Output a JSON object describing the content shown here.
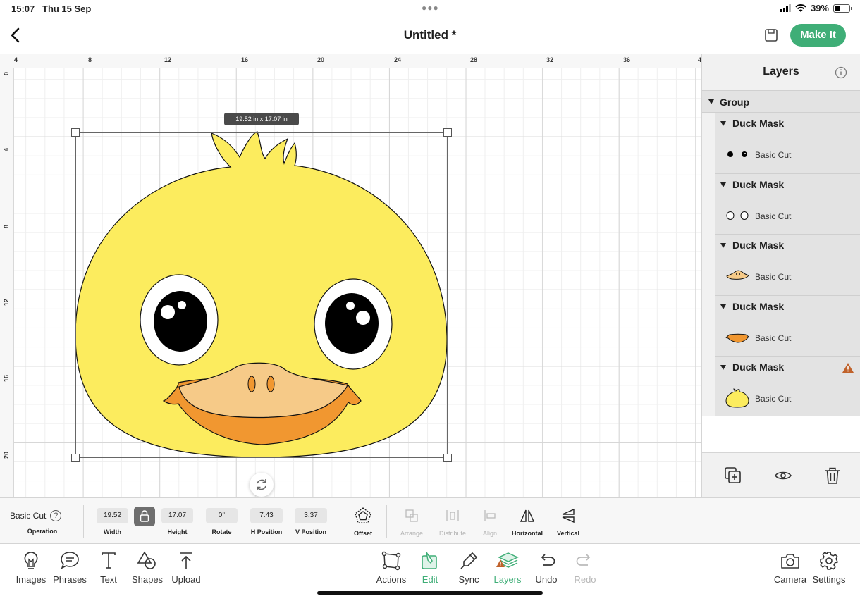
{
  "status_bar": {
    "time": "15:07",
    "date": "Thu 15 Sep",
    "battery": "39%",
    "battery_level": 0.39
  },
  "header": {
    "title": "Untitled *",
    "make_it_label": "Make It",
    "accent_color": "#3fae77"
  },
  "canvas": {
    "ruler_top": [
      "4",
      "8",
      "12",
      "16",
      "20",
      "24",
      "28",
      "32",
      "36",
      "4"
    ],
    "ruler_left": [
      "0",
      "4",
      "8",
      "12",
      "16",
      "20"
    ],
    "size_tooltip": "19.52 in x 17.07 in"
  },
  "layers_panel": {
    "title": "Layers",
    "group_label": "Group",
    "items": [
      {
        "name": "Duck Mask",
        "layer": "Basic Cut",
        "thumb": "pupils",
        "warning": false
      },
      {
        "name": "Duck Mask",
        "layer": "Basic Cut",
        "thumb": "eye-whites",
        "warning": false
      },
      {
        "name": "Duck Mask",
        "layer": "Basic Cut",
        "thumb": "beak-top",
        "warning": false
      },
      {
        "name": "Duck Mask",
        "layer": "Basic Cut",
        "thumb": "beak-bottom",
        "warning": true
      },
      {
        "name": "Duck Mask",
        "layer": "Basic Cut",
        "thumb": "duck-head",
        "warning": true
      }
    ]
  },
  "edit_toolbar": {
    "operation_value": "Basic Cut",
    "operation_label": "Operation",
    "width_value": "19.52",
    "width_label": "Width",
    "height_value": "17.07",
    "height_label": "Height",
    "rotate_value": "0°",
    "rotate_label": "Rotate",
    "hpos_value": "7.43",
    "hpos_label": "H Position",
    "vpos_value": "3.37",
    "vpos_label": "V Position",
    "offset_label": "Offset",
    "arrange_label": "Arrange",
    "distribute_label": "Distribute",
    "align_label": "Align",
    "horizontal_label": "Horizontal",
    "vertical_label": "Vertical"
  },
  "bottom_nav": {
    "images": "Images",
    "phrases": "Phrases",
    "text": "Text",
    "shapes": "Shapes",
    "upload": "Upload",
    "actions": "Actions",
    "edit": "Edit",
    "sync": "Sync",
    "layers": "Layers",
    "undo": "Undo",
    "redo": "Redo",
    "camera": "Camera",
    "settings": "Settings"
  }
}
